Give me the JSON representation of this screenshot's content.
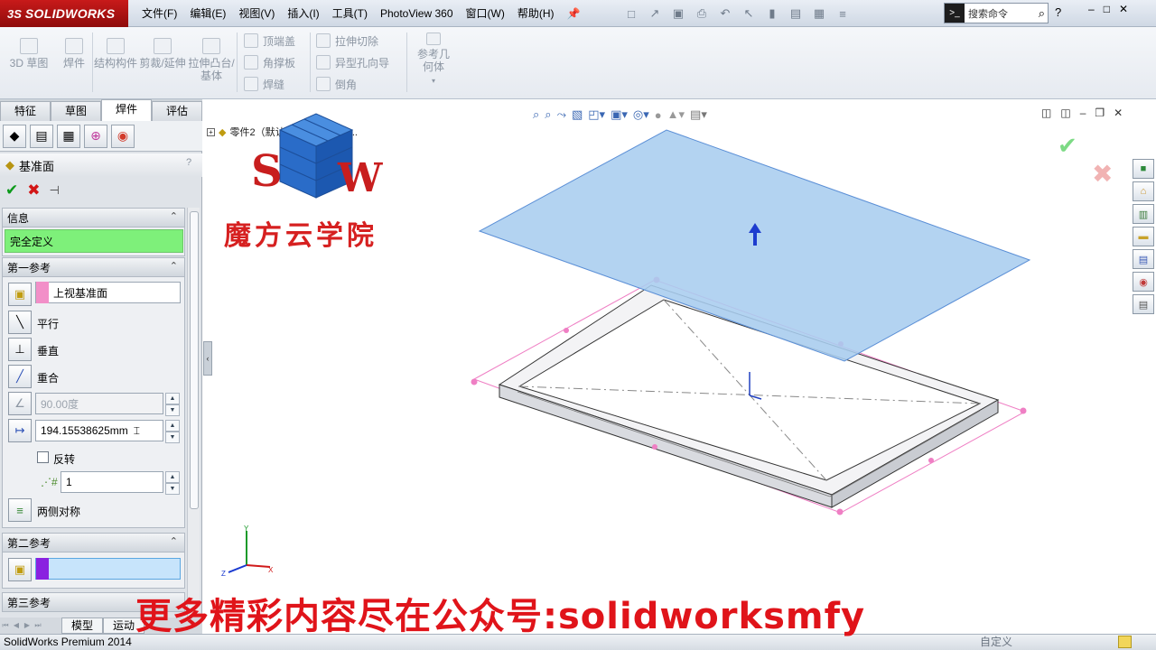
{
  "app": {
    "logo_ds": "3S",
    "logo_name": "SOLIDWORKS",
    "menus": [
      "文件(F)",
      "编辑(E)",
      "视图(V)",
      "插入(I)",
      "工具(T)",
      "PhotoView 360",
      "窗口(W)",
      "帮助(H)"
    ],
    "search_placeholder": "搜索命令",
    "help": "?"
  },
  "command_manager": {
    "big_buttons": [
      "3D 草图",
      "焊件",
      "结构构件",
      "剪裁/延伸",
      "拉伸凸台/基体"
    ],
    "col1": [
      "顶端盖",
      "角撑板",
      "焊缝"
    ],
    "col2": [
      "拉伸切除",
      "异型孔向导",
      "倒角"
    ],
    "ref_geom": "参考几何体"
  },
  "left_panel": {
    "tabs": [
      "特征",
      "草图",
      "焊件",
      "评估"
    ],
    "active_tab": "焊件",
    "title": "基准面",
    "info_header": "信息",
    "info_status": "完全定义",
    "first_ref_header": "第一参考",
    "first_ref_value": "上视基准面",
    "parallel": "平行",
    "perpendicular": "垂直",
    "coincident": "重合",
    "angle_value": "90.00度",
    "distance_value": "194.15538625mm",
    "flip_label": "反转",
    "instances_value": "1",
    "mid_plane": "两侧对称",
    "second_ref_header": "第二参考",
    "third_ref_header": "第三参考"
  },
  "bottom_tabs": [
    "模型",
    "运动"
  ],
  "status": {
    "app_name": "SolidWorks Premium 2014",
    "right_text": "自定义"
  },
  "viewport": {
    "tree_label": "零件2（默认<<按加工>< < ..."
  },
  "overlay": {
    "school_name": "魔方云学院",
    "caption": "更多精彩内容尽在公众号:solidworksmfy"
  },
  "colors": {
    "plane_fill": "#a9cdef",
    "plane_stroke": "#5b8fd6",
    "selection_pink": "#ef7fc4",
    "status_green": "#7ef07a",
    "caption_red": "#e0141a"
  }
}
